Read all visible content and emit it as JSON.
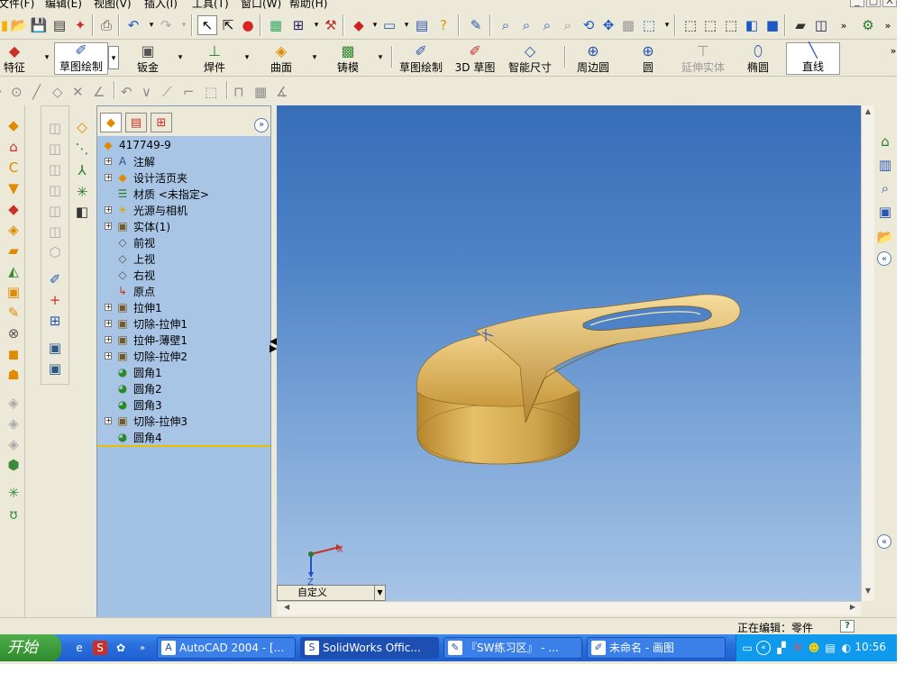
{
  "menu": [
    {
      "label": "文件(F)"
    },
    {
      "label": "编辑(E)"
    },
    {
      "label": "视图(V)"
    },
    {
      "label": "插入(I)"
    },
    {
      "label": "工具(T)"
    },
    {
      "label": "窗口(W)"
    },
    {
      "label": "帮助(H)"
    }
  ],
  "window_controls": [
    "_",
    "□",
    "X"
  ],
  "command_manager": {
    "features": "特征",
    "sketch": "草图绘制",
    "sheet_metal": "钣金",
    "weldments": "焊件",
    "surfaces": "曲面",
    "molds": "铸模",
    "sketch2": "草图绘制",
    "sketch3d": "3D 草图",
    "smart_dim": "智能尺寸",
    "perimeter_circle": "周边圆",
    "circle": "圆",
    "extend_entity": "延伸实体",
    "ellipse": "椭圆",
    "line": "直线"
  },
  "feature_tree": {
    "part_name": "417749-9",
    "items": [
      {
        "label": "注解",
        "expand": true,
        "icon": "annotation-icon"
      },
      {
        "label": "设计活页夹",
        "expand": true,
        "icon": "binder-icon"
      },
      {
        "label": "材质 <未指定>",
        "expand": false,
        "icon": "material-icon"
      },
      {
        "label": "光源与相机",
        "expand": true,
        "icon": "lights-icon"
      },
      {
        "label": "实体(1)",
        "expand": true,
        "icon": "solid-body-icon"
      },
      {
        "label": "前视",
        "expand": false,
        "icon": "plane-icon"
      },
      {
        "label": "上视",
        "expand": false,
        "icon": "plane-icon"
      },
      {
        "label": "右视",
        "expand": false,
        "icon": "plane-icon"
      },
      {
        "label": "原点",
        "expand": false,
        "icon": "origin-icon"
      },
      {
        "label": "拉伸1",
        "expand": true,
        "icon": "extrude-icon"
      },
      {
        "label": "切除-拉伸1",
        "expand": true,
        "icon": "cut-extrude-icon"
      },
      {
        "label": "拉伸-薄壁1",
        "expand": true,
        "icon": "thin-extrude-icon"
      },
      {
        "label": "切除-拉伸2",
        "expand": true,
        "icon": "cut-extrude-icon"
      },
      {
        "label": "圆角1",
        "expand": false,
        "icon": "fillet-icon"
      },
      {
        "label": "圆角2",
        "expand": false,
        "icon": "fillet-icon"
      },
      {
        "label": "圆角3",
        "expand": false,
        "icon": "fillet-icon"
      },
      {
        "label": "切除-拉伸3",
        "expand": true,
        "icon": "cut-extrude-icon"
      },
      {
        "label": "圆角4",
        "expand": false,
        "icon": "fillet-icon"
      }
    ]
  },
  "view_selector": "自定义",
  "triad": {
    "x": "X",
    "z": "Z"
  },
  "status": {
    "text": "正在编辑：零件",
    "help": "?"
  },
  "taskbar": {
    "start": "开始",
    "tasks": [
      {
        "label": "AutoCAD 2004 - [...",
        "active": false
      },
      {
        "label": "SolidWorks Offic...",
        "active": true
      },
      {
        "label": "『SW练习区』 - ...",
        "active": false
      },
      {
        "label": "未命名 - 画图",
        "active": false
      }
    ],
    "clock": "10:56"
  },
  "colors": {
    "viewport_top": "#386db8",
    "viewport_bottom": "#a7c4e6",
    "part": "#d7a845",
    "tree_bg": "#a9c5e6"
  }
}
